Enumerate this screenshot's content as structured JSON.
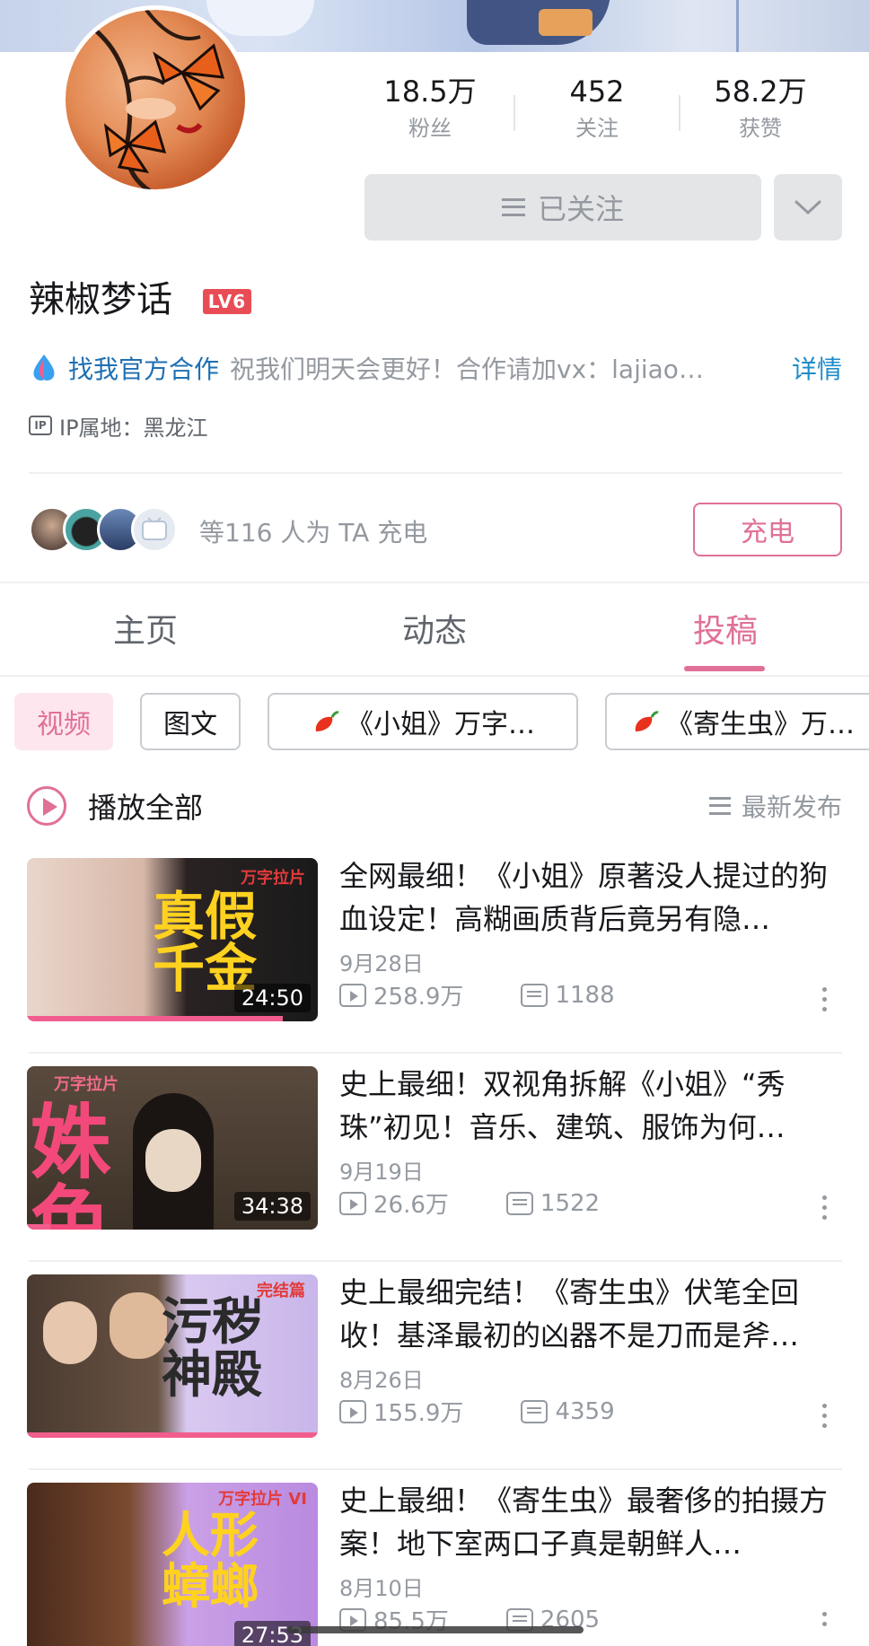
{
  "profile": {
    "username": "辣椒梦话",
    "level": "LV6",
    "stats": [
      {
        "value": "18.5万",
        "label": "粉丝"
      },
      {
        "value": "452",
        "label": "关注"
      },
      {
        "value": "58.2万",
        "label": "获赞"
      }
    ],
    "follow_label": "已关注",
    "coop_link": "找我官方合作",
    "bio": "祝我们明天会更好！合作请加vx：lajiao…",
    "detail_label": "详情",
    "ip": "IP属地：黑龙江",
    "charge_text": "等116 人为 TA 充电",
    "charge_button": "充电"
  },
  "tabs": [
    "主页",
    "动态",
    "投稿"
  ],
  "active_tab": "投稿",
  "chips": [
    "视频",
    "图文",
    "《小姐》万字…",
    "《寄生虫》万…"
  ],
  "list_header": {
    "play_all": "播放全部",
    "sort": "最新发布"
  },
  "videos": [
    {
      "title": "全网最细！《小姐》原著没人提过的狗血设定！高糊画质背后竟另有隐…",
      "date": "9月28日",
      "views": "258.9万",
      "danmaku": "1188",
      "duration": "24:50",
      "progress": 0.88,
      "thumb_text": "真假千金",
      "thumb_tag": "万字拉片"
    },
    {
      "title": "史上最细！双视角拆解《小姐》“秀珠”初见！音乐、建筑、服饰为何…",
      "date": "9月19日",
      "views": "26.6万",
      "danmaku": "1522",
      "duration": "34:38",
      "progress": 0.08,
      "thumb_text": "姝色",
      "thumb_tag": "万字拉片"
    },
    {
      "title": "史上最细完结！《寄生虫》伏笔全回收！基泽最初的凶器不是刀而是斧…",
      "date": "8月26日",
      "views": "155.9万",
      "danmaku": "4359",
      "duration": "",
      "progress": 1.0,
      "thumb_text": "污秽神殿",
      "thumb_tag": "完结篇"
    },
    {
      "title": "史上最细！《寄生虫》最奢侈的拍摄方案！地下室两口子真是朝鲜人…",
      "date": "8月10日",
      "views": "85.5万",
      "danmaku": "2605",
      "duration": "27:53",
      "progress": 0.0,
      "thumb_text": "人形蟑螂",
      "thumb_tag": "万字拉片 VI"
    }
  ],
  "colors": {
    "accent": "#e07098",
    "link": "#1e6fb3",
    "muted": "#9499a0"
  }
}
